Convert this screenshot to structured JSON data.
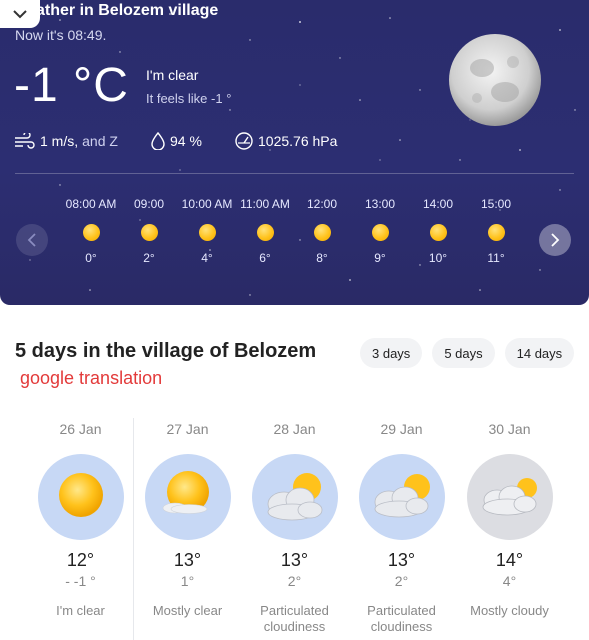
{
  "header": {
    "title": "ather in Belozem village",
    "now": "Now it's 08:49."
  },
  "current": {
    "temp": "-1 °C",
    "condition": "I'm clear",
    "feels_like": "It feels like -1 °"
  },
  "metrics": {
    "wind": "1 m/s,",
    "wind_dir": "and Z",
    "humidity": "94 %",
    "pressure": "1025.76 hPa"
  },
  "hourly": [
    {
      "time": "08:00 AM",
      "temp": "0°"
    },
    {
      "time": "09:00",
      "temp": "2°"
    },
    {
      "time": "10:00 AM",
      "temp": "4°"
    },
    {
      "time": "11:00 AM",
      "temp": "6°"
    },
    {
      "time": "12:00",
      "temp": "8°"
    },
    {
      "time": "13:00",
      "temp": "9°"
    },
    {
      "time": "14:00",
      "temp": "10°"
    },
    {
      "time": "15:00",
      "temp": "11°"
    }
  ],
  "forecast": {
    "heading": "5 days in the village of Belozem",
    "tabs": [
      "3 days",
      "5 days",
      "14 days"
    ],
    "note": "google translation",
    "days": [
      {
        "date": "26 Jan",
        "high": "12°",
        "low": "- -1 °",
        "desc": "I'm clear",
        "icon": "sun-icon"
      },
      {
        "date": "27 Jan",
        "high": "13°",
        "low": "1°",
        "desc": "Mostly clear",
        "icon": "sun-small-cloud-icon"
      },
      {
        "date": "28 Jan",
        "high": "13°",
        "low": "2°",
        "desc": "Particulated cloudiness",
        "icon": "partly-cloudy-icon"
      },
      {
        "date": "29 Jan",
        "high": "13°",
        "low": "2°",
        "desc": "Particulated cloudiness",
        "icon": "partly-cloudy-icon"
      },
      {
        "date": "30 Jan",
        "high": "14°",
        "low": "4°",
        "desc": "Mostly cloudy",
        "icon": "mostly-cloudy-icon"
      }
    ]
  },
  "colors": {
    "hero_bg": "#2a2c6c",
    "sun": "#ffc21b",
    "note": "#e33a3a",
    "day_icon_bg": "#c7d8f5"
  }
}
